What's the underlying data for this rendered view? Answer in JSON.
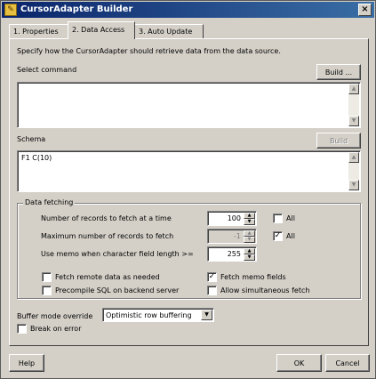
{
  "window": {
    "title": "CursorAdapter Builder",
    "close_glyph": "×",
    "app_icon_glyph": "✎"
  },
  "tabs": [
    {
      "label": "1. Properties"
    },
    {
      "label": "2. Data Access"
    },
    {
      "label": "3. Auto Update"
    }
  ],
  "data_access": {
    "intro": "Specify how the CursorAdapter should retrieve data from the data source.",
    "select_command": {
      "label": "Select command",
      "build_label": "Build ...",
      "value": ""
    },
    "schema": {
      "label": "Schema",
      "build_label": "Build",
      "value": "F1 C(10)"
    },
    "data_fetching": {
      "legend": "Data fetching",
      "records_fetch": {
        "label": "Number of records to fetch at a time",
        "value": "100",
        "all_label": "All",
        "all_checked": false
      },
      "max_records": {
        "label": "Maximum number of records to fetch",
        "value": "-1",
        "all_label": "All",
        "all_checked": true
      },
      "memo_length": {
        "label": "Use memo when character field length >=",
        "value": "255"
      },
      "fetch_remote": {
        "label": "Fetch remote data as needed",
        "checked": false
      },
      "fetch_memo": {
        "label": "Fetch memo fields",
        "checked": true
      },
      "precompile": {
        "label": "Precompile SQL on backend server",
        "checked": false
      },
      "allow_simultaneous": {
        "label": "Allow simultaneous fetch",
        "checked": false
      }
    },
    "buffer_mode": {
      "label": "Buffer mode override",
      "value": "Optimistic row buffering"
    },
    "break_on_error": {
      "label": "Break on error",
      "checked": false
    }
  },
  "footer": {
    "help_label": "Help",
    "ok_label": "OK",
    "cancel_label": "Cancel"
  },
  "glyphs": {
    "up": "▲",
    "down": "▼",
    "check": "✓"
  }
}
